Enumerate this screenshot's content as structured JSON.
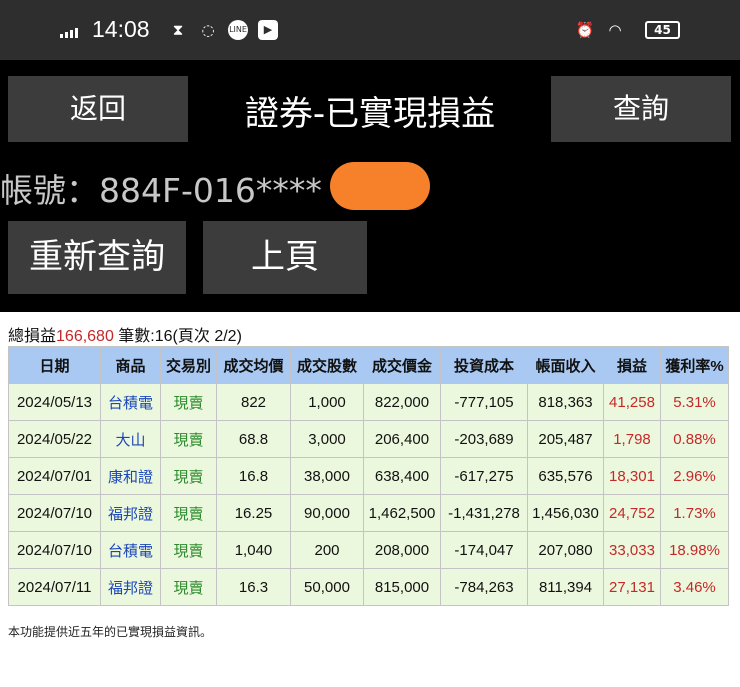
{
  "status_bar": {
    "time": "14:08",
    "battery": "45",
    "icons": [
      "signal-icon",
      "app-icon",
      "whatsapp-icon",
      "line-icon",
      "youtube-icon",
      "alarm-icon",
      "wifi-icon",
      "battery-icon"
    ]
  },
  "header": {
    "back_label": "返回",
    "title": "證券-已實現損益",
    "query_label": "查詢"
  },
  "account": {
    "label": "帳號：884F-016****"
  },
  "actions": {
    "requery_label": "重新查詢",
    "prev_page_label": "上頁"
  },
  "summary": {
    "total_label": "總損益",
    "total_value": "166,680",
    "count_text": " 筆數:16(頁次 2/2)"
  },
  "table": {
    "headers": [
      "日期",
      "商品",
      "交易別",
      "成交均價",
      "成交股數",
      "成交價金",
      "投資成本",
      "帳面收入",
      "損益",
      "獲利率%"
    ],
    "rows": [
      [
        "2024/05/13",
        "台積電",
        "現賣",
        "822",
        "1,000",
        "822,000",
        "-777,105",
        "818,363",
        "41,258",
        "5.31%"
      ],
      [
        "2024/05/22",
        "大山",
        "現賣",
        "68.8",
        "3,000",
        "206,400",
        "-203,689",
        "205,487",
        "1,798",
        "0.88%"
      ],
      [
        "2024/07/01",
        "康和證",
        "現賣",
        "16.8",
        "38,000",
        "638,400",
        "-617,275",
        "635,576",
        "18,301",
        "2.96%"
      ],
      [
        "2024/07/10",
        "福邦證",
        "現賣",
        "16.25",
        "90,000",
        "1,462,500",
        "-1,431,278",
        "1,456,030",
        "24,752",
        "1.73%"
      ],
      [
        "2024/07/10",
        "台積電",
        "現賣",
        "1,040",
        "200",
        "208,000",
        "-174,047",
        "207,080",
        "33,033",
        "18.98%"
      ],
      [
        "2024/07/11",
        "福邦證",
        "現賣",
        "16.3",
        "50,000",
        "815,000",
        "-784,263",
        "811,394",
        "27,131",
        "3.46%"
      ]
    ]
  },
  "footer": {
    "note": "本功能提供近五年的已實現損益資訊。"
  }
}
